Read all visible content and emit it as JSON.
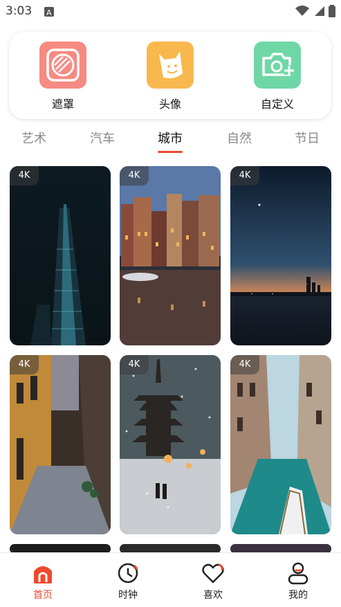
{
  "status": {
    "time": "3:03"
  },
  "features": [
    {
      "label": "遮罩",
      "icon": "mask-icon",
      "color": "#f58b83"
    },
    {
      "label": "头像",
      "icon": "avatar-icon",
      "color": "#f8b84e"
    },
    {
      "label": "自定义",
      "icon": "camera-add-icon",
      "color": "#6fd7a6"
    }
  ],
  "tabs": [
    {
      "label": "艺术",
      "active": false
    },
    {
      "label": "汽车",
      "active": false
    },
    {
      "label": "城市",
      "active": true
    },
    {
      "label": "自然",
      "active": false
    },
    {
      "label": "节日",
      "active": false
    }
  ],
  "wallpapers": [
    {
      "badge": "4K",
      "subject": "night-skyscraper"
    },
    {
      "badge": "4K",
      "subject": "canal-houses-reflection"
    },
    {
      "badge": "4K",
      "subject": "city-skyline-dusk"
    },
    {
      "badge": "4K",
      "subject": "alley-street"
    },
    {
      "badge": "4K",
      "subject": "pagoda-snow"
    },
    {
      "badge": "4K",
      "subject": "venice-canal"
    }
  ],
  "nav": [
    {
      "label": "首页",
      "icon": "home-icon",
      "active": true
    },
    {
      "label": "时钟",
      "icon": "clock-icon",
      "active": false
    },
    {
      "label": "喜欢",
      "icon": "heart-icon",
      "active": false
    },
    {
      "label": "我的",
      "icon": "profile-icon",
      "active": false
    }
  ],
  "colors": {
    "accent": "#ee4a2e"
  }
}
